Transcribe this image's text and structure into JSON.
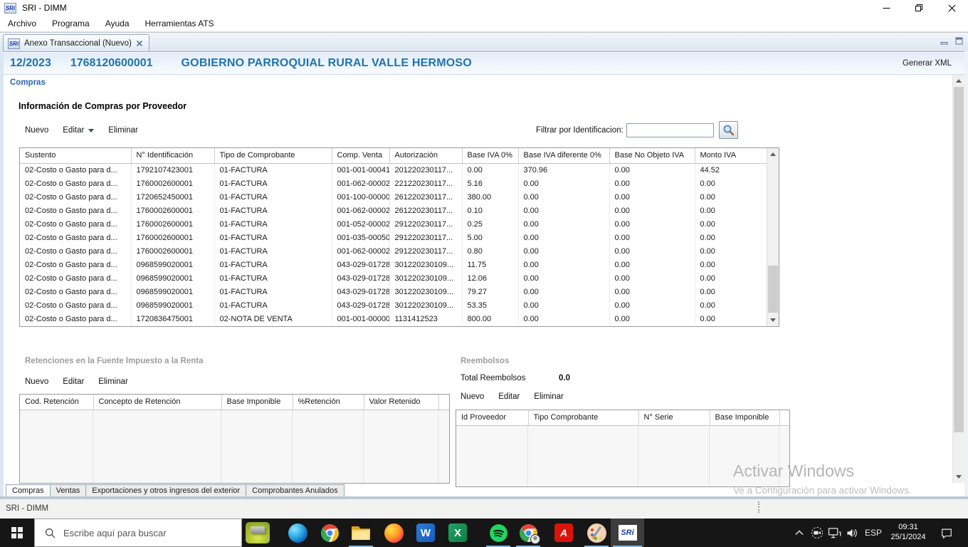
{
  "window": {
    "title": "SRI - DIMM",
    "logo_text": "SRi"
  },
  "menu_bar": {
    "items": [
      "Archivo",
      "Programa",
      "Ayuda",
      "Herramientas ATS"
    ]
  },
  "editor_tab": {
    "label": "Anexo Transaccional (Nuevo)"
  },
  "doc_header": {
    "period": "12/2023",
    "ruc": "1768120600001",
    "entity_name": "GOBIERNO PARROQUIAL RURAL VALLE HERMOSO",
    "generate_xml_label": "Generar XML"
  },
  "compras": {
    "section_label": "Compras",
    "panel_title": "Información de Compras por Proveedor",
    "toolbar": {
      "nuevo": "Nuevo",
      "editar": "Editar",
      "eliminar": "Eliminar"
    },
    "filter": {
      "label": "Filtrar por Identificacion:",
      "value": ""
    },
    "table": {
      "headers": [
        "Sustento",
        "N° Identificación",
        "Tipo de Comprobante",
        "Comp. Venta",
        "Autorización",
        "Base IVA 0%",
        "Base IVA diferente 0%",
        "Base No Objeto IVA",
        "Monto IVA"
      ],
      "rows": [
        [
          "02-Costo o Gasto para d...",
          "1792107423001",
          "01-FACTURA",
          "001-001-00041...",
          "201220230117...",
          "0.00",
          "370.96",
          "0.00",
          "44.52"
        ],
        [
          "02-Costo o Gasto para d...",
          "1760002600001",
          "01-FACTURA",
          "001-062-00002...",
          "221220230117...",
          "5.16",
          "0.00",
          "0.00",
          "0.00"
        ],
        [
          "02-Costo o Gasto para d...",
          "1720652450001",
          "01-FACTURA",
          "001-100-00000...",
          "261220230117...",
          "380.00",
          "0.00",
          "0.00",
          "0.00"
        ],
        [
          "02-Costo o Gasto para d...",
          "1760002600001",
          "01-FACTURA",
          "001-062-00002...",
          "261220230117...",
          "0.10",
          "0.00",
          "0.00",
          "0.00"
        ],
        [
          "02-Costo o Gasto para d...",
          "1760002600001",
          "01-FACTURA",
          "001-052-00002...",
          "291220230117...",
          "0.25",
          "0.00",
          "0.00",
          "0.00"
        ],
        [
          "02-Costo o Gasto para d...",
          "1760002600001",
          "01-FACTURA",
          "001-035-00050...",
          "291220230117...",
          "5.00",
          "0.00",
          "0.00",
          "0.00"
        ],
        [
          "02-Costo o Gasto para d...",
          "1760002600001",
          "01-FACTURA",
          "001-062-00002...",
          "291220230117...",
          "0.80",
          "0.00",
          "0.00",
          "0.00"
        ],
        [
          "02-Costo o Gasto para d...",
          "0968599020001",
          "01-FACTURA",
          "043-029-01728...",
          "301220230109...",
          "11.75",
          "0.00",
          "0.00",
          "0.00"
        ],
        [
          "02-Costo o Gasto para d...",
          "0968599020001",
          "01-FACTURA",
          "043-029-01728...",
          "301220230109...",
          "12.06",
          "0.00",
          "0.00",
          "0.00"
        ],
        [
          "02-Costo o Gasto para d...",
          "0968599020001",
          "01-FACTURA",
          "043-029-01728...",
          "301220230109...",
          "79.27",
          "0.00",
          "0.00",
          "0.00"
        ],
        [
          "02-Costo o Gasto para d...",
          "0968599020001",
          "01-FACTURA",
          "043-029-01728...",
          "301220230109...",
          "53.35",
          "0.00",
          "0.00",
          "0.00"
        ],
        [
          "02-Costo o Gasto para d...",
          "1720836475001",
          "02-NOTA DE VENTA",
          "001-001-00000...",
          "1131412523",
          "800.00",
          "0.00",
          "0.00",
          "0.00"
        ]
      ]
    }
  },
  "retenciones": {
    "section_title": "Retenciones en la Fuente  Impuesto a la Renta",
    "toolbar": {
      "nuevo": "Nuevo",
      "editar": "Editar",
      "eliminar": "Eliminar"
    },
    "table": {
      "headers": [
        "Cod. Retención",
        "Concepto de Retención",
        "Base Imponible",
        "%Retención",
        "Valor Retenido"
      ],
      "rows": []
    }
  },
  "reembolsos": {
    "section_title": "Reembolsos",
    "total_label": "Total Reembolsos",
    "total_value": "0.0",
    "toolbar": {
      "nuevo": "Nuevo",
      "editar": "Editar",
      "eliminar": "Eliminar"
    },
    "table": {
      "headers": [
        "Id Proveedor",
        "Tipo Comprobante",
        "N° Serie",
        "Base Imponible"
      ],
      "rows": []
    }
  },
  "bottom_tabs": {
    "tabs": [
      "Compras",
      "Ventas",
      "Exportaciones y otros ingresos del exterior",
      "Comprobantes Anulados"
    ],
    "active": "Compras"
  },
  "status_bar": {
    "text": "SRI - DIMM"
  },
  "watermark": {
    "line1": "Activar Windows",
    "line2": "Ve a Configuración para activar Windows."
  },
  "taskbar": {
    "search_placeholder": "Escribe aquí para buscar",
    "sri_logo_text": "SRi",
    "word_letter": "W",
    "excel_letter": "X",
    "acrobat_letter": "A",
    "tray": {
      "language": "ESP",
      "time": "09:31",
      "date": "25/1/2024"
    }
  },
  "colors": {
    "header_text_blue": "#1f74ae",
    "section_blue": "#2a67b8",
    "disabled_gray": "#9d9d9d",
    "taskbar_bg": "#161616",
    "running_underline": "#76b9ed"
  }
}
